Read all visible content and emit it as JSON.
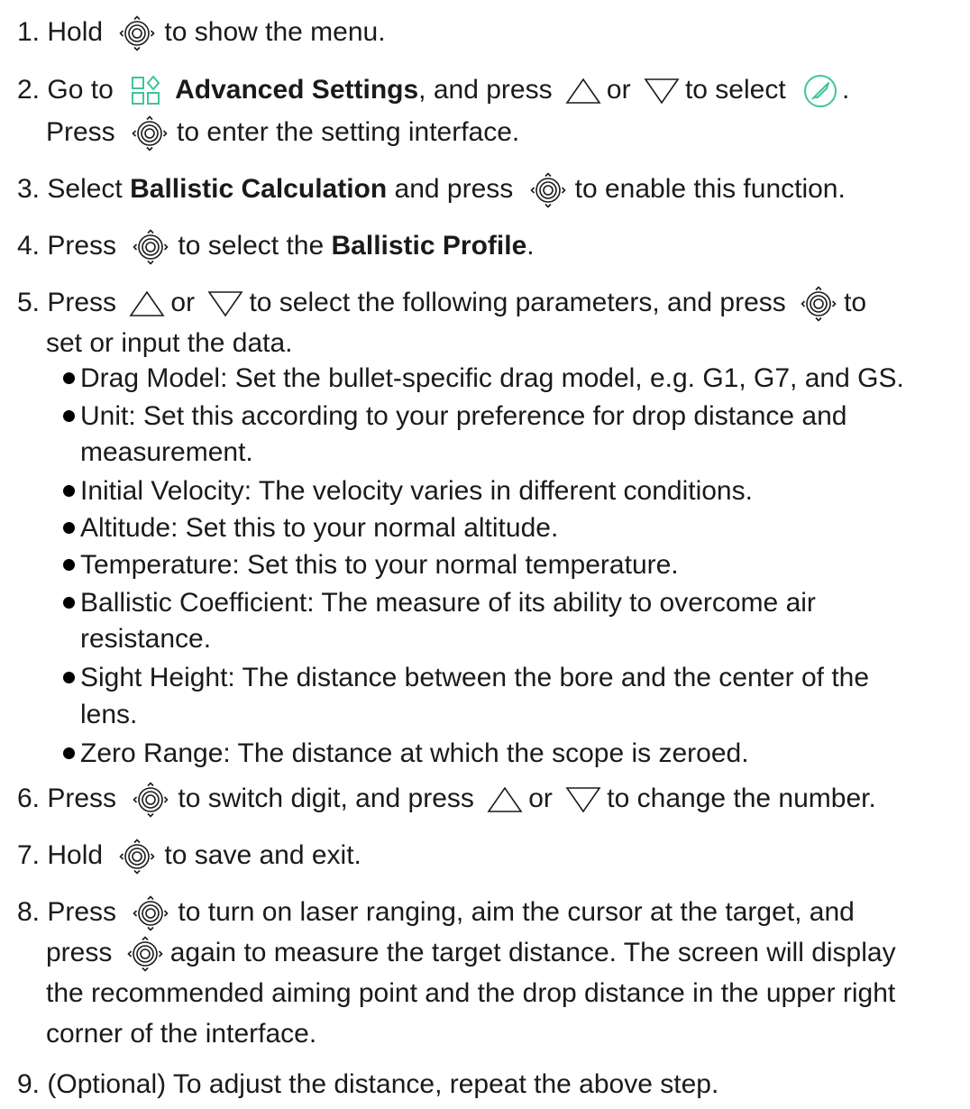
{
  "steps": [
    {
      "num": "1.",
      "pre": "Hold",
      "post": "to show the menu."
    },
    {
      "num": "2.",
      "pre": "Go to",
      "bold1": "Advanced Settings",
      "mid": ", and press",
      "or": "or",
      "post": "to select",
      "end": ".",
      "cont_pre": "Press",
      "cont_post": "to enter the setting interface."
    },
    {
      "num": "3.",
      "pre": "Select",
      "bold1": "Ballistic Calculation",
      "mid": "and press",
      "post": "to enable this function."
    },
    {
      "num": "4.",
      "pre": "Press",
      "mid": "to select the",
      "bold1": "Ballistic Profile",
      "end": "."
    },
    {
      "num": "5.",
      "pre": "Press",
      "or": "or",
      "mid": "to select the following parameters, and press",
      "post": "to",
      "cont": "set or input the data."
    },
    {
      "num": "6.",
      "pre": "Press",
      "mid": "to switch digit, and press",
      "or": "or",
      "post": "to change the number."
    },
    {
      "num": "7.",
      "pre": "Hold",
      "post": "to save and exit."
    },
    {
      "num": "8.",
      "pre": "Press",
      "post": "to turn on laser ranging, aim the cursor at the target, and",
      "l2_pre": "press",
      "l2_post": "again to measure the target distance. The screen will display",
      "l3": "the recommended aiming point and the drop distance in the upper right",
      "l4": "corner of the interface."
    },
    {
      "num": "9.",
      "text": "(Optional) To adjust the distance, repeat the above step."
    }
  ],
  "params": [
    {
      "l1": "Drag Model: Set the bullet-specific drag model, e.g. G1, G7, and GS."
    },
    {
      "l1": "Unit: Set this according to your preference for drop distance and",
      "l2": "measurement."
    },
    {
      "l1": "Initial Velocity: The velocity varies in different conditions."
    },
    {
      "l1": "Altitude: Set this to your normal altitude."
    },
    {
      "l1": "Temperature: Set this to your normal temperature."
    },
    {
      "l1": "Ballistic Coefficient: The measure of its ability to overcome air",
      "l2": "resistance."
    },
    {
      "l1": "Sight Height: The distance between the bore and the center of the",
      "l2": "lens."
    },
    {
      "l1": "Zero Range: The distance at which the scope is zeroed."
    }
  ],
  "icons": {
    "select_knob": "target-knob-icon",
    "up": "triangle-up-icon",
    "down": "triangle-down-icon",
    "advanced_settings": "advanced-settings-icon",
    "ballistic": "ballistic-bullet-icon"
  },
  "colors": {
    "text": "#1a1a1a",
    "accent": "#3fc59a"
  }
}
